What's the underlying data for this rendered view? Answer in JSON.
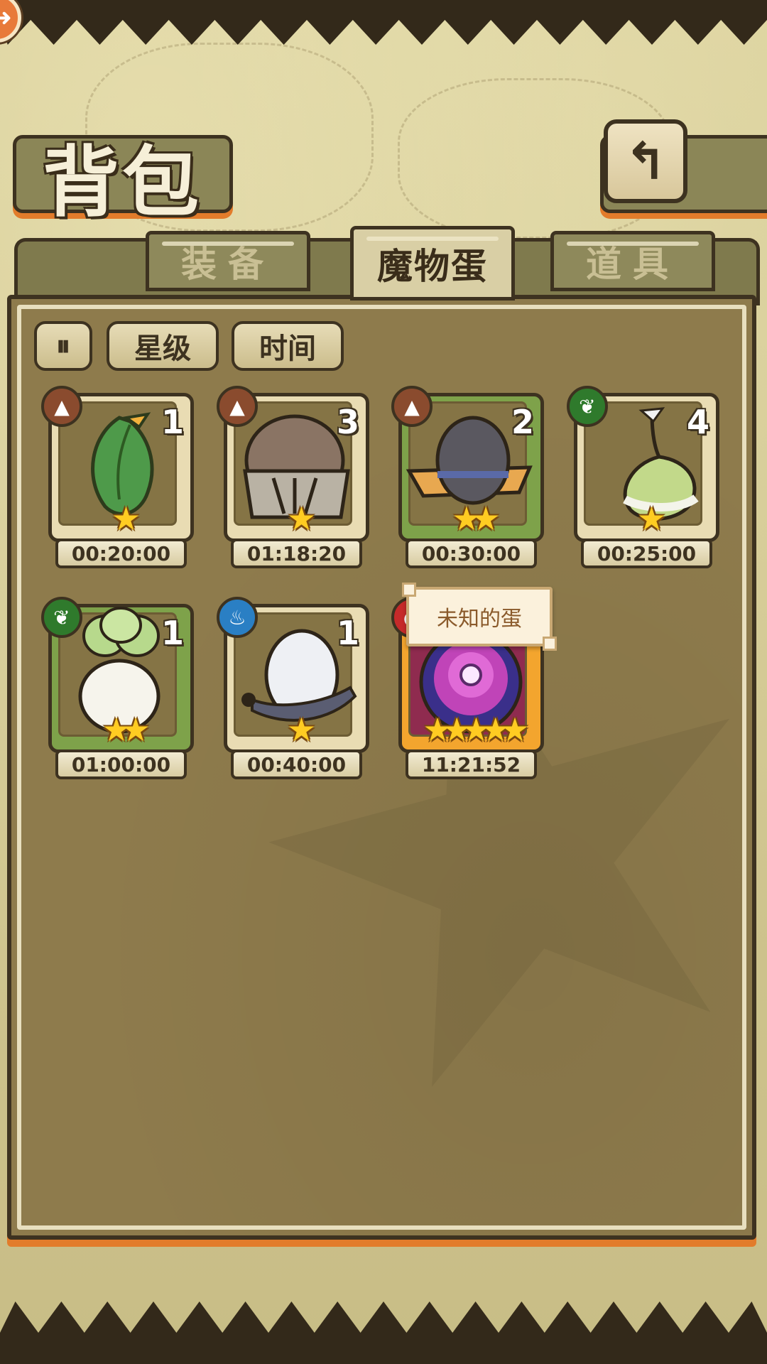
{
  "header": {
    "title": "背包",
    "back_icon": "return-arrow-icon"
  },
  "tabs": [
    {
      "label": "装备",
      "active": false
    },
    {
      "label": "魔物蛋",
      "active": true
    },
    {
      "label": "道具",
      "active": false
    }
  ],
  "sort_buttons": {
    "order_icon": "sort-order-icon",
    "star_label": "星级",
    "time_label": "时间"
  },
  "eggs": [
    {
      "element": "earth",
      "count": "1",
      "stars": 1,
      "timer": "00:20:00"
    },
    {
      "element": "earth",
      "count": "3",
      "stars": 1,
      "timer": "01:18:20"
    },
    {
      "element": "earth",
      "count": "2",
      "stars": 2,
      "timer": "00:30:00"
    },
    {
      "element": "leaf",
      "count": "4",
      "stars": 1,
      "timer": "00:25:00"
    },
    {
      "element": "leaf",
      "count": "1",
      "stars": 2,
      "timer": "01:00:00"
    },
    {
      "element": "steam",
      "count": "1",
      "stars": 1,
      "timer": "00:40:00"
    },
    {
      "element": "fire",
      "count": "",
      "stars": 5,
      "timer": "11:21:52"
    }
  ],
  "tooltip": {
    "text": "未知的蛋"
  },
  "colors": {
    "earth": "#8a4b2e",
    "leaf": "#2f7a2c",
    "steam": "#2a7fc4",
    "fire": "#c62a2a",
    "accent_orange": "#e27c2b"
  }
}
